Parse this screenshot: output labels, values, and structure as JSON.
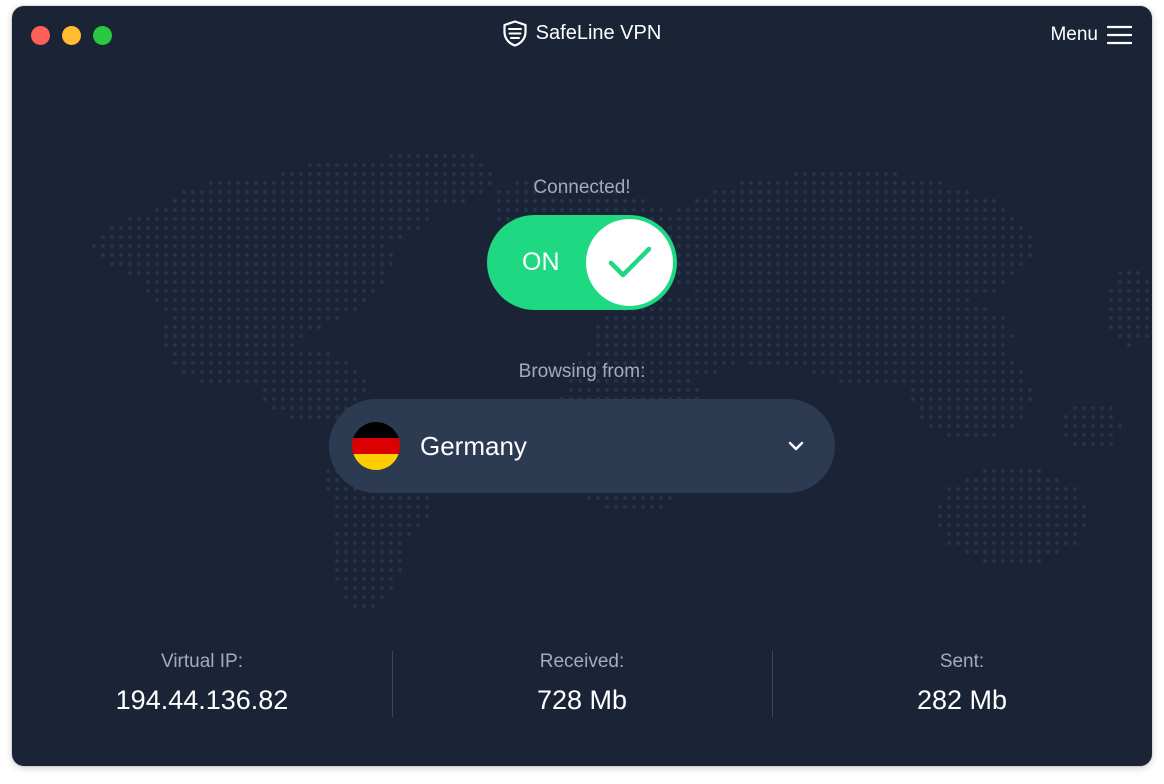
{
  "window": {
    "traffic_lights": [
      {
        "name": "close",
        "color": "#fe5f57"
      },
      {
        "name": "minimize",
        "color": "#febc2e"
      },
      {
        "name": "zoom",
        "color": "#28c840"
      }
    ],
    "title": "SafeLine VPN",
    "title_icon": "shield-icon",
    "menu_label": "Menu",
    "menu_icon": "hamburger-icon"
  },
  "connection": {
    "status": "Connected!",
    "toggle_label": "ON",
    "toggle_on": true,
    "toggle_color": "#1ed882",
    "check_icon": "checkmark-icon"
  },
  "location": {
    "label": "Browsing from:",
    "country": "Germany",
    "flag_icon": "germany-flag-icon",
    "flag_colors": [
      "#000000",
      "#dd0000",
      "#ffce00"
    ],
    "dropdown_icon": "chevron-down-icon"
  },
  "stats": [
    {
      "label": "Virtual IP:",
      "value": "194.44.136.82"
    },
    {
      "label": "Received:",
      "value": "728 Mb"
    },
    {
      "label": "Sent:",
      "value": "282 Mb"
    }
  ],
  "theme": {
    "background": "#1b2436",
    "panel": "#2c3a52",
    "muted_text": "#a4abba",
    "map_dots": "#26324a"
  }
}
